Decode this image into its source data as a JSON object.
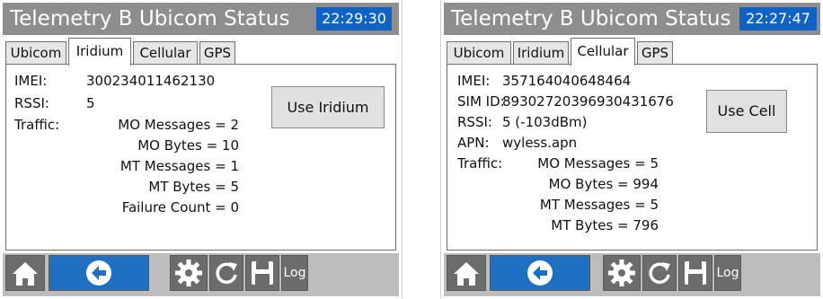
{
  "left": {
    "title": "Telemetry B Ubicom Status",
    "time": "22:29:30",
    "tabs": [
      "Ubicom",
      "Iridium",
      "Cellular",
      "GPS"
    ],
    "active_tab": "Iridium",
    "imei_label": "IMEI:",
    "imei": "300234011462130",
    "rssi_label": "RSSI:",
    "rssi": "5",
    "traffic_label": "Traffic:",
    "metrics": [
      "MO Messages = 2",
      "MO Bytes = 10",
      "MT Messages = 1",
      "MT Bytes = 5",
      "Failure Count = 0"
    ],
    "action_label": "Use Iridium",
    "log_label": "Log"
  },
  "right": {
    "title": "Telemetry B Ubicom Status",
    "time": "22:27:47",
    "tabs": [
      "Ubicom",
      "Iridium",
      "Cellular",
      "GPS"
    ],
    "active_tab": "Cellular",
    "imei_label": "IMEI:",
    "imei": "357164040648464",
    "sim_label": "SIM ID:",
    "sim": "89302720396930431676",
    "rssi_label": "RSSI:",
    "rssi": "5 (-103dBm)",
    "apn_label": "APN:",
    "apn": "wyless.apn",
    "traffic_label": "Traffic:",
    "metrics": [
      "MO Messages = 5",
      "MO Bytes = 994",
      "MT Messages = 5",
      "MT Bytes = 796"
    ],
    "action_label": "Use Cell",
    "log_label": "Log"
  },
  "icons": {
    "home": "home-icon",
    "back": "back-arrow-icon",
    "settings": "gear-icon",
    "refresh": "refresh-icon",
    "save": "save-disk-icon"
  },
  "colors": {
    "titlebar": "#8e8e8e",
    "clock": "#0e63c4",
    "toolbar": "#bdbdbd",
    "back_button": "#1f6fc3",
    "tool_button": "#6c6c6c"
  }
}
